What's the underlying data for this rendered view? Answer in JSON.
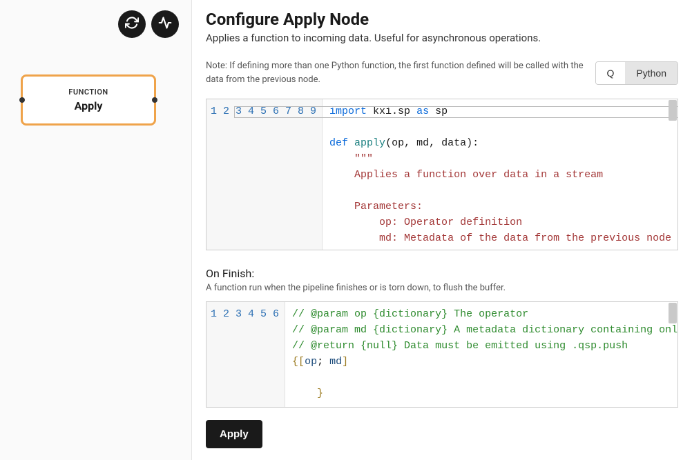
{
  "left": {
    "node": {
      "category": "FUNCTION",
      "title": "Apply"
    },
    "icons": {
      "refresh": "refresh-icon",
      "activity": "activity-icon"
    }
  },
  "header": {
    "title": "Configure Apply Node",
    "subtitle": "Applies a function to incoming data. Useful for asynchronous operations.",
    "note": "Note: If defining more than one Python function, the first function defined will be called with the data from the previous node."
  },
  "lang": {
    "q": "Q",
    "python": "Python",
    "active": "Python"
  },
  "editor1": {
    "lines": [
      {
        "n": 1,
        "tokens": [
          [
            "import ",
            "kw"
          ],
          [
            "kxi.sp ",
            ""
          ],
          [
            "as ",
            "kw"
          ],
          [
            "sp",
            ""
          ]
        ]
      },
      {
        "n": 2,
        "tokens": [
          [
            "",
            ""
          ]
        ]
      },
      {
        "n": 3,
        "tokens": [
          [
            "def ",
            "kw"
          ],
          [
            "apply",
            "fn"
          ],
          [
            "(op, md, data):",
            ""
          ]
        ]
      },
      {
        "n": 4,
        "tokens": [
          [
            "    ",
            ""
          ],
          [
            "\"\"\"",
            "str"
          ]
        ]
      },
      {
        "n": 5,
        "tokens": [
          [
            "    ",
            ""
          ],
          [
            "Applies a function over data in a stream",
            "str"
          ]
        ]
      },
      {
        "n": 6,
        "tokens": [
          [
            "",
            ""
          ]
        ]
      },
      {
        "n": 7,
        "tokens": [
          [
            "    ",
            ""
          ],
          [
            "Parameters:",
            "str"
          ]
        ]
      },
      {
        "n": 8,
        "tokens": [
          [
            "        ",
            ""
          ],
          [
            "op: Operator definition",
            "str"
          ]
        ]
      },
      {
        "n": 9,
        "tokens": [
          [
            "        ",
            ""
          ],
          [
            "md: Metadata of the data from the previous node",
            "str"
          ]
        ]
      }
    ]
  },
  "onfinish": {
    "title": "On Finish:",
    "desc": "A function run when the pipeline finishes or is torn down, to flush the buffer."
  },
  "editor2": {
    "lines": [
      {
        "n": 1,
        "tokens": [
          [
            "// @param op {dictionary} The operator",
            "com"
          ]
        ]
      },
      {
        "n": 2,
        "tokens": [
          [
            "// @param md {dictionary} A metadata dictionary containing only the key",
            "com"
          ]
        ]
      },
      {
        "n": 3,
        "tokens": [
          [
            "// @return {null} Data must be emitted using .qsp.push",
            "com"
          ]
        ]
      },
      {
        "n": 4,
        "tokens": [
          [
            "{",
            "br"
          ],
          [
            "[",
            "br"
          ],
          [
            "op",
            "id"
          ],
          [
            "; ",
            ""
          ],
          [
            "md",
            "id"
          ],
          [
            "]",
            "br"
          ]
        ]
      },
      {
        "n": 5,
        "tokens": [
          [
            "",
            ""
          ]
        ]
      },
      {
        "n": 6,
        "tokens": [
          [
            "    ",
            ""
          ],
          [
            "}",
            "br"
          ]
        ]
      }
    ]
  },
  "apply_button": "Apply"
}
